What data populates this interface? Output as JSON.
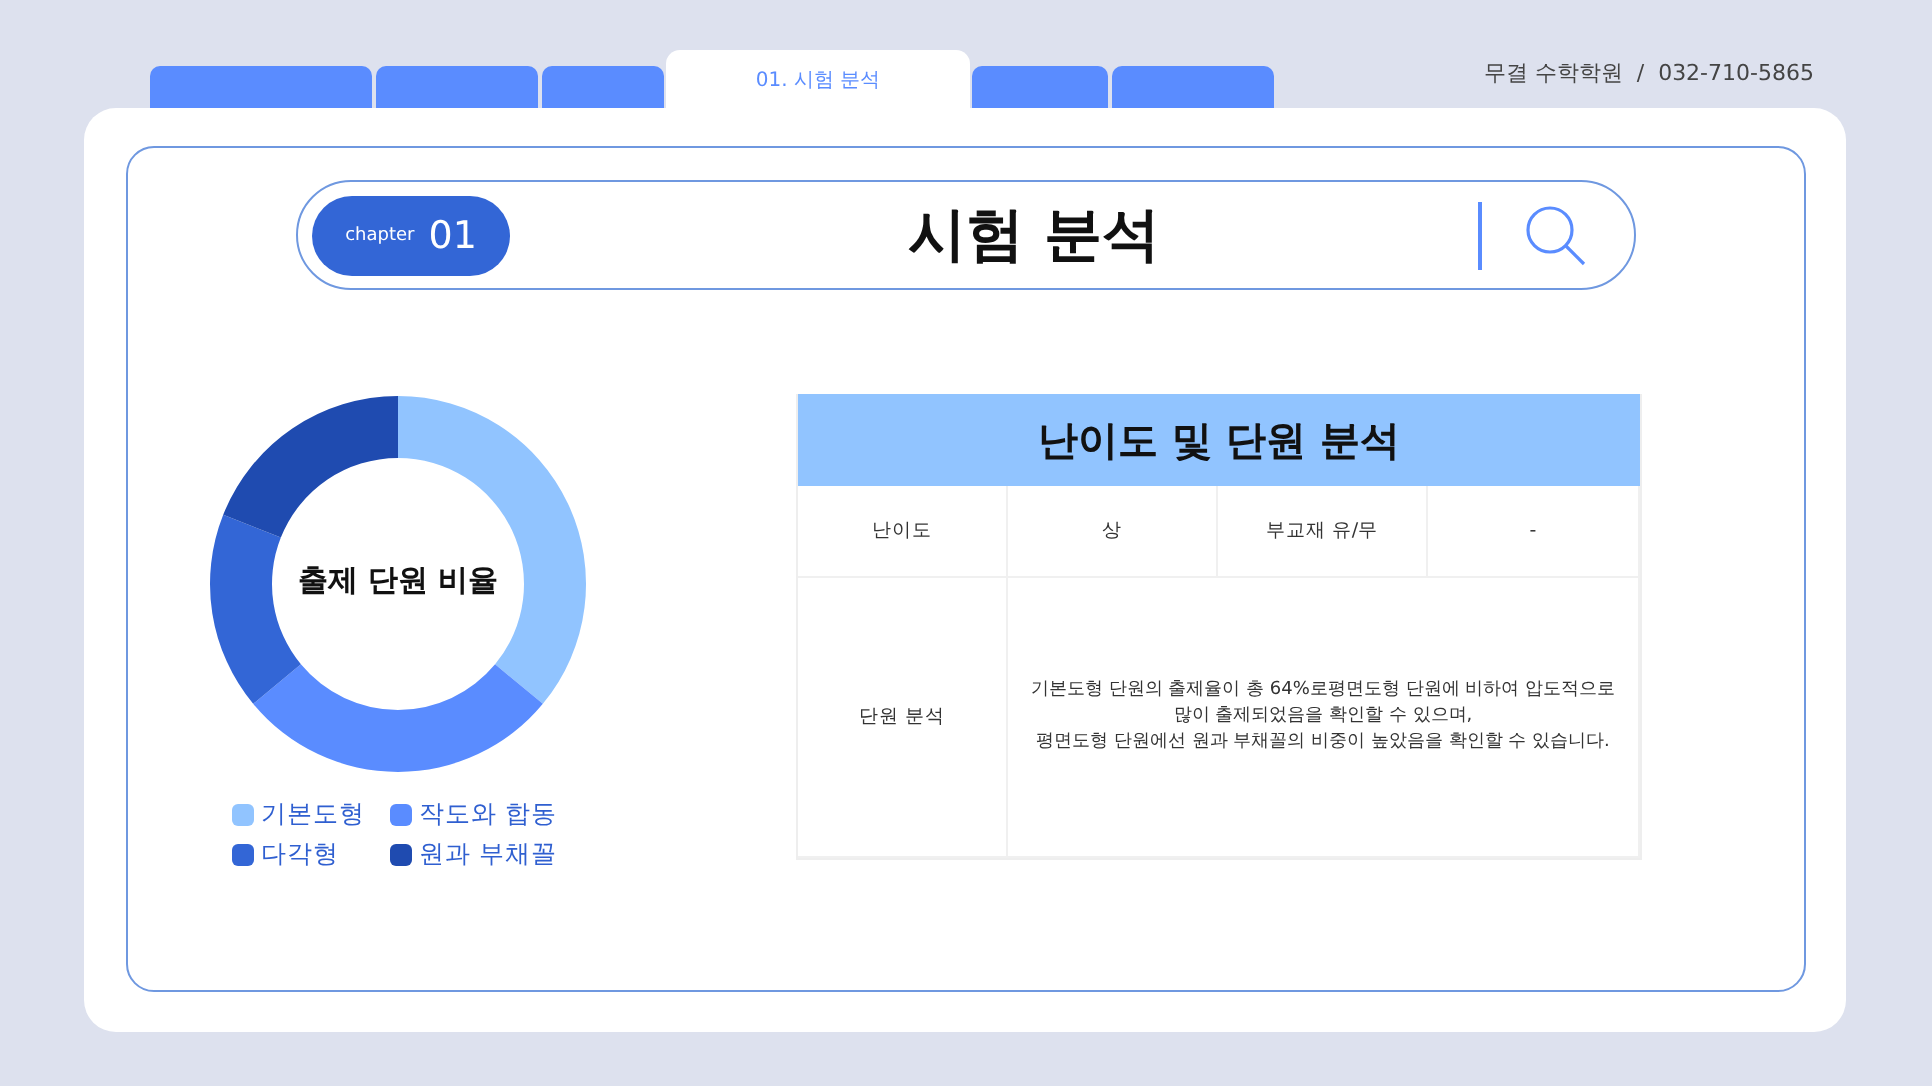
{
  "tabs": [
    {
      "selected": false
    },
    {
      "selected": false
    },
    {
      "selected": false
    },
    {
      "label": "01. 시험 분석",
      "selected": true
    },
    {
      "selected": false
    },
    {
      "selected": false
    }
  ],
  "contact": "무결 수학학원  /  032-710-5865",
  "header": {
    "chapter_label": "chapter",
    "chapter_number": "01",
    "title": "시험 분석"
  },
  "donut": {
    "center_label": "출제 단원 비율",
    "legend": [
      {
        "label": "기본도형",
        "color": "#91c4ff"
      },
      {
        "label": "작도와 합동",
        "color": "#5a8cff"
      },
      {
        "label": "다각형",
        "color": "#3366d6"
      },
      {
        "label": "원과 부채꼴",
        "color": "#1f4bb0"
      }
    ]
  },
  "table": {
    "title": "난이도 및 단원 분석",
    "rows": [
      {
        "kind": "pairs",
        "cells": [
          "난이도",
          "상",
          "부교재 유/무",
          "-"
        ]
      },
      {
        "kind": "wide",
        "cells": [
          "단원 분석",
          "기본도형 단원의 출제율이 총 64%로평면도형 단원에 비하여 압도적으로\n많이 출제되었음을 확인할 수 있으며,\n평면도형 단원에선 원과 부채꼴의 비중이 높았음을 확인할 수 있습니다."
        ]
      }
    ]
  }
}
